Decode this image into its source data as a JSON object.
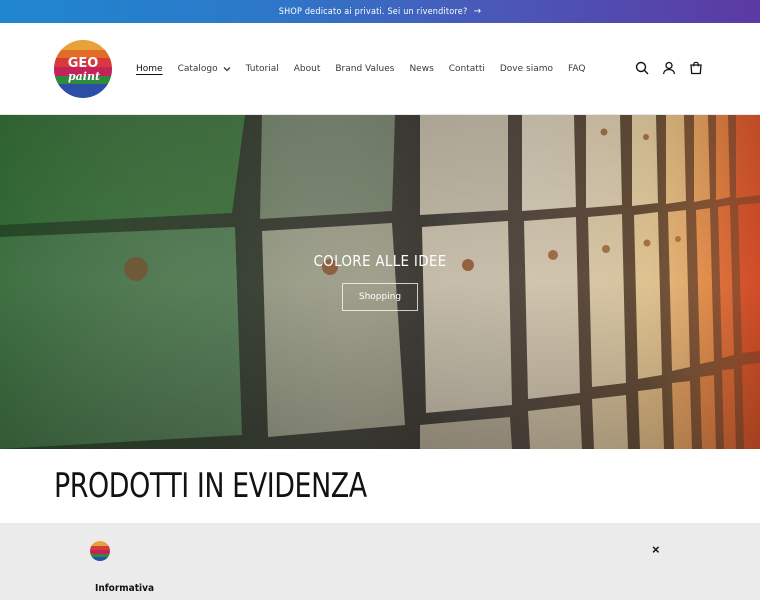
{
  "announcement": {
    "text": "SHOP dedicato ai privati. Sei un rivenditore?",
    "arrow": "→"
  },
  "header": {
    "logo_text": [
      "GEO",
      "paint"
    ],
    "nav": [
      {
        "label": "Home",
        "active": true
      },
      {
        "label": "Catalogo",
        "dropdown": true
      },
      {
        "label": "Tutorial"
      },
      {
        "label": "About"
      },
      {
        "label": "Brand Values"
      },
      {
        "label": "News"
      },
      {
        "label": "Contatti"
      },
      {
        "label": "Dove siamo"
      },
      {
        "label": "FAQ"
      }
    ],
    "icons": [
      "search-icon",
      "account-icon",
      "cart-icon"
    ]
  },
  "hero": {
    "title": "COLORE ALLE IDEE",
    "button": "Shopping"
  },
  "featured": {
    "title": "PRODOTTI IN EVIDENZA"
  },
  "cookie": {
    "close": "×",
    "heading": "Informativa"
  },
  "colors": {
    "announce_start": "#1f86cf",
    "announce_end": "#5b3aa3",
    "cookie_bg": "#ebebeb"
  }
}
